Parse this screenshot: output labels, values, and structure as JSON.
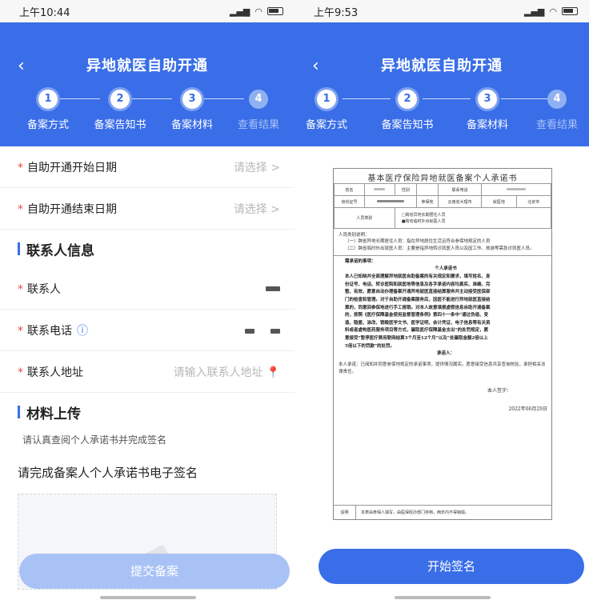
{
  "left": {
    "time": "上午10:44",
    "title": "异地就医自助开通",
    "steps": [
      {
        "num": "1",
        "label": "备案方式"
      },
      {
        "num": "2",
        "label": "备案告知书"
      },
      {
        "num": "3",
        "label": "备案材料"
      },
      {
        "num": "4",
        "label": "查看结果"
      }
    ],
    "start_date": {
      "label": "自助开通开始日期",
      "placeholder": "请选择 >"
    },
    "end_date": {
      "label": "自助开通结束日期",
      "placeholder": "请选择 >"
    },
    "contact_section": "联系人信息",
    "contact_name": {
      "label": "联系人"
    },
    "contact_phone": {
      "label": "联系电话"
    },
    "contact_address": {
      "label": "联系人地址",
      "placeholder": "请输入联系人地址"
    },
    "materials_section": "材料上传",
    "materials_tip": "请认真查阅个人承诺书并完成签名",
    "signature_title": "请完成备案人个人承诺书电子签名",
    "submit_label": "提交备案"
  },
  "right": {
    "time": "上午9:53",
    "title": "异地就医自助开通",
    "steps": [
      {
        "num": "1",
        "label": "备案方式"
      },
      {
        "num": "2",
        "label": "备案告知书"
      },
      {
        "num": "3",
        "label": "备案材料"
      },
      {
        "num": "4",
        "label": "查看结果"
      }
    ],
    "doc": {
      "title": "基本医疗保险异地就医备案个人承诺书",
      "name_label": "姓名",
      "gender_label": "性别",
      "phone_label": "联系电话",
      "id_label": "身份证号",
      "insured_label": "参保地",
      "insured_value": "云南省大理市",
      "residence_label": "就医地",
      "residence_value": "北京市",
      "type_label": "人员类别",
      "type_opt1": "□跨省异地长期居住人员",
      "type_opt2": "■跨省临时外出就医人员",
      "notes_title": "人员类别说明：",
      "note1": "（一）跨省异地长期居住人员：指在异地居住生活且符合参保地规定的人员",
      "note2": "（二）跨省临时外出就医人员：主要是指异地转诊就医人员以及因工作、旅游等需急诊就医人员。",
      "pledge_heading": "需承诺的事项：",
      "pledge_sub": "个人承诺书",
      "pledge_text": "本人已知晓并全面理解异地就医自助备案的有关规定和要求，填写姓名、身份证号、电话、转诊医院和就医地等信息及各字承诺内容均真实、准确、完整、有效，愿意自动办理备案开通异地就医直接结算服务并主动接受医保部门的检查和管理。对于自助开通备案服务后，因医不能进行异地就医直接结算的，同意回参保地进行手工报销。对本人故意填报虚假信息自助开通备案的，按照《医疗保障基金使用监督管理条例》第四十一条中“通过伪造、变造、隐匿、涂改、销毁医学文书、医学证明、会计凭证、电子信息等有关资料或者虚构医药服务项目等方式，骗取医疗保障基金支出”的处罚规定，愿意接受“暂停医疗费用联网结算3个月至12个月”以及“处骗取金额2倍以上5倍以下的罚款”的处罚。",
      "pledgee": "承诺人：",
      "final_pledge": "本人承诺：已阅知并同意参保地规定的承诺事项，提供情况属实。愿意接受信息共享查询核验，承担相关法律责任。",
      "sign_label": "本人签字：",
      "date": "2022年06月29日",
      "foot_label": "说明",
      "foot_text": "本表由参保人填写，由医保经办部门存档，两年内不得销毁。"
    },
    "sign_button": "开始签名"
  },
  "colors": {
    "primary": "#3a6ee8",
    "disabled": "#a9c2f5",
    "required": "#e74c3c"
  }
}
